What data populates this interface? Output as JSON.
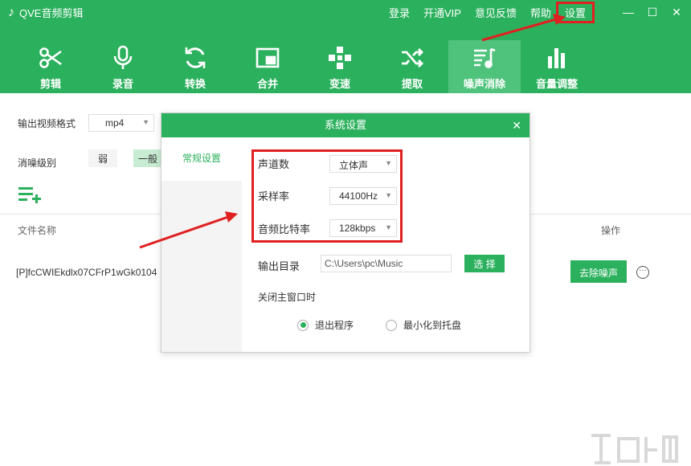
{
  "app": {
    "title": "QVE音频剪辑"
  },
  "topnav": {
    "login": "登录",
    "vip": "开通VIP",
    "feedback": "意见反馈",
    "help": "帮助",
    "settings": "设置"
  },
  "tools": [
    {
      "label": "剪辑",
      "icon": "scissors-icon"
    },
    {
      "label": "录音",
      "icon": "microphone-icon"
    },
    {
      "label": "转换",
      "icon": "refresh-icon"
    },
    {
      "label": "合并",
      "icon": "merge-icon"
    },
    {
      "label": "变速",
      "icon": "speed-icon"
    },
    {
      "label": "提取",
      "icon": "shuffle-icon"
    },
    {
      "label": "噪声消除",
      "icon": "noise-icon"
    },
    {
      "label": "音量调整",
      "icon": "volume-bars-icon"
    }
  ],
  "main": {
    "format_label": "输出视频格式",
    "format_value": "mp4",
    "level_label": "消噪级别",
    "level_weak": "弱",
    "level_mid": "一般",
    "col_filename": "文件名称",
    "col_action": "操作",
    "file_name": "[P]fcCWIEkdlx07CFrP1wGk0104",
    "remove_noise": "去除噪声"
  },
  "dialog": {
    "title": "系统设置",
    "tab": "常规设置",
    "channels_label": "声道数",
    "channels_value": "立体声",
    "samplerate_label": "采样率",
    "samplerate_value": "44100Hz",
    "bitrate_label": "音频比特率",
    "bitrate_value": "128kbps",
    "outdir_label": "输出目录",
    "outdir_value": "C:\\Users\\pc\\Music",
    "choose": "选 择",
    "close_label": "关闭主窗口时",
    "opt_exit": "退出程序",
    "opt_tray": "最小化到托盘"
  },
  "colors": {
    "brand": "#2bb15d",
    "highlight": "#e02020"
  }
}
